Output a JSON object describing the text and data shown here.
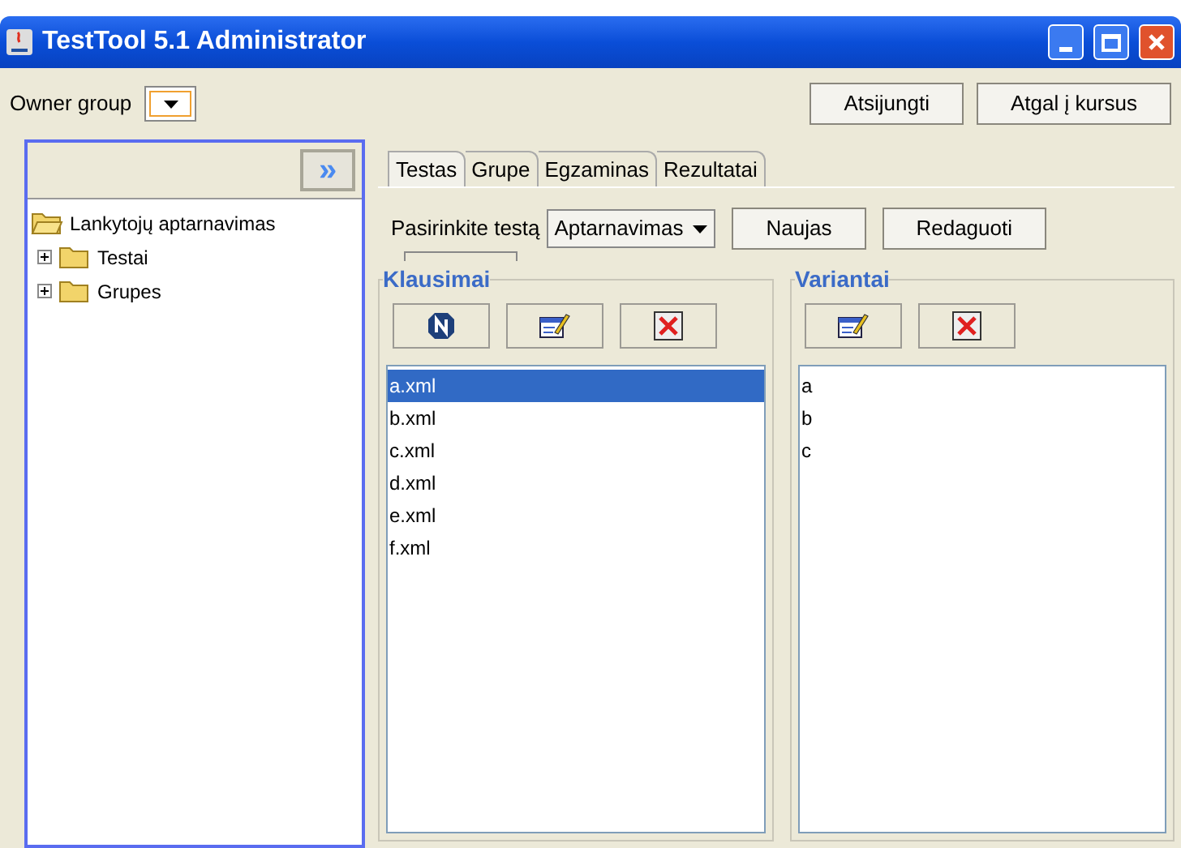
{
  "window": {
    "title": "TestTool 5.1 Administrator"
  },
  "toolbar": {
    "owner_label": "Owner group",
    "buttons": [
      "Atsijungti",
      "Atgal į kursus"
    ]
  },
  "sidebar": {
    "collapse": "»",
    "tree": [
      {
        "label": "Lankytojų aptarnavimas",
        "expanded": true,
        "children": [
          {
            "label": "Testai",
            "expanded": false
          },
          {
            "label": "Grupes",
            "expanded": false
          }
        ]
      }
    ]
  },
  "tabs": [
    {
      "label": "Testas",
      "selected": true
    },
    {
      "label": "Grupe",
      "selected": false
    },
    {
      "label": "Egzaminas",
      "selected": false
    },
    {
      "label": "Rezultatai",
      "selected": false
    }
  ],
  "test_select": {
    "label": "Pasirinkite testą",
    "value": "Aptarnavimas",
    "buttons": [
      "Naujas",
      "Redaguoti"
    ]
  },
  "questions": {
    "title": "Klausimai",
    "tools": [
      {
        "kind": "new"
      },
      {
        "kind": "edit"
      },
      {
        "kind": "delete"
      }
    ],
    "items": [
      {
        "label": "a.xml",
        "selected": true
      },
      {
        "label": "b.xml",
        "selected": false
      },
      {
        "label": "c.xml",
        "selected": false
      },
      {
        "label": "d.xml",
        "selected": false
      },
      {
        "label": "e.xml",
        "selected": false
      },
      {
        "label": "f.xml",
        "selected": false
      }
    ]
  },
  "variants": {
    "title": "Variantai",
    "tools": [
      {
        "kind": "edit"
      },
      {
        "kind": "delete"
      }
    ],
    "items": [
      {
        "label": "a",
        "selected": false
      },
      {
        "label": "b",
        "selected": false
      },
      {
        "label": "c",
        "selected": false
      }
    ]
  }
}
